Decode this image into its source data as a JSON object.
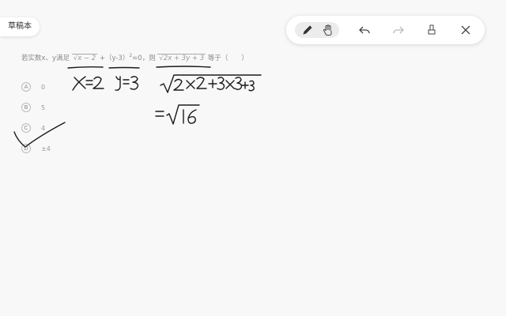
{
  "draft": {
    "label": "草稿本"
  },
  "toolbar": {
    "tools": [
      {
        "name": "pen",
        "icon": "pen-icon",
        "active": true
      },
      {
        "name": "hand",
        "icon": "hand-icon",
        "active": false
      },
      {
        "name": "undo",
        "icon": "undo-icon",
        "active": false
      },
      {
        "name": "redo",
        "icon": "redo-icon",
        "active": false
      },
      {
        "name": "eraser",
        "icon": "eraser-icon",
        "active": false
      },
      {
        "name": "close",
        "icon": "close-icon",
        "active": false
      }
    ]
  },
  "question": {
    "prefix": "若实数x、y满足",
    "sqrt1": "x − 2",
    "mid": "+（y-3）",
    "sup": "2",
    "mid2": "=0，则",
    "sqrt2": "2x + 3y + 3",
    "suffix": "等于（　　）"
  },
  "options": [
    {
      "key": "A",
      "text": "0"
    },
    {
      "key": "B",
      "text": "5"
    },
    {
      "key": "C",
      "text": "4"
    },
    {
      "key": "D",
      "text": "±4"
    }
  ],
  "handwriting": {
    "line1": "x=2  y=3",
    "line2": "√(2×2+3×3+3)",
    "line3": "=√16",
    "mark": "check-mark on option C"
  },
  "colors": {
    "ink": "#1a1a1a",
    "background": "#f8f8f8",
    "panel": "#ffffff"
  }
}
